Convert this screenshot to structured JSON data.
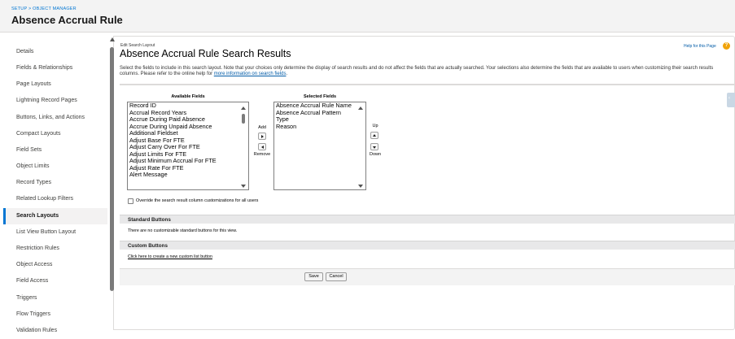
{
  "header": {
    "breadcrumb": "SETUP > OBJECT MANAGER",
    "title": "Absence Accrual Rule"
  },
  "sidebar": {
    "items": [
      {
        "label": "Details"
      },
      {
        "label": "Fields & Relationships"
      },
      {
        "label": "Page Layouts"
      },
      {
        "label": "Lightning Record Pages"
      },
      {
        "label": "Buttons, Links, and Actions"
      },
      {
        "label": "Compact Layouts"
      },
      {
        "label": "Field Sets"
      },
      {
        "label": "Object Limits"
      },
      {
        "label": "Record Types"
      },
      {
        "label": "Related Lookup Filters"
      },
      {
        "label": "Search Layouts"
      },
      {
        "label": "List View Button Layout"
      },
      {
        "label": "Restriction Rules"
      },
      {
        "label": "Object Access"
      },
      {
        "label": "Field Access"
      },
      {
        "label": "Triggers"
      },
      {
        "label": "Flow Triggers"
      },
      {
        "label": "Validation Rules"
      }
    ],
    "active": "Search Layouts"
  },
  "main": {
    "edit_label": "Edit Search Layout",
    "title": "Absence Accrual Rule Search Results",
    "help_link": "Help for this Page",
    "description": "Select the fields to include in this search layout. Note that your choices only determine the display of search results and do not affect the fields that are actually searched. Your selections also determine the fields that are available to users when customizing their search results columns. Please refer to the online help for ",
    "description_link": "more information on search fields",
    "description_end": ".",
    "available_header": "Available Fields",
    "selected_header": "Selected Fields",
    "available_fields": [
      "Record ID",
      "Accrual Record Years",
      "Accrue During Paid Absence",
      "Accrue During Unpaid Absence",
      "Additional Fieldset",
      "Adjust Base For FTE",
      "Adjust Carry Over For FTE",
      "Adjust Limits For FTE",
      "Adjust Minimum Accrual For FTE",
      "Adjust Rate For FTE",
      "Alert Message"
    ],
    "selected_fields": [
      "Absence Accrual Rule Name",
      "Absence Accrual Pattern",
      "Type",
      "Reason"
    ],
    "add_label": "Add",
    "remove_label": "Remove",
    "up_label": "Up",
    "down_label": "Down",
    "override_label": "Override the search result column customizations for all users",
    "override_checked": false,
    "standard_buttons_title": "Standard Buttons",
    "standard_buttons_text": "There are no customizable standard buttons for this view.",
    "custom_buttons_title": "Custom Buttons",
    "custom_buttons_link": "Click here to create a new custom list button",
    "save_label": "Save",
    "cancel_label": "Cancel"
  },
  "colors": {
    "accent": "#0176d3",
    "help_icon": "#f0a30a",
    "section_bar": "#e8e8e9"
  }
}
